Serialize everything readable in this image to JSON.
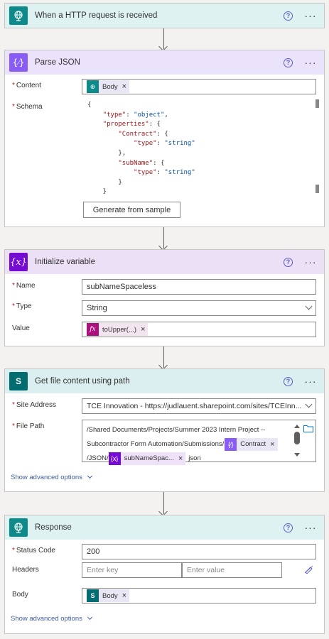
{
  "steps": {
    "trigger": {
      "title": "When a HTTP request is received",
      "help": "?",
      "more": "···"
    },
    "parse_json": {
      "title": "Parse JSON",
      "help": "?",
      "more": "···",
      "content_label": "Content",
      "content_token": "Body",
      "schema_label": "Schema",
      "schema_lines": [
        "{",
        "    \"type\": \"object\",",
        "    \"properties\": {",
        "        \"Contract\": {",
        "            \"type\": \"string\"",
        "        },",
        "        \"subName\": {",
        "            \"type\": \"string\"",
        "        }",
        "    }"
      ],
      "generate_button": "Generate from sample"
    },
    "init_var": {
      "title": "Initialize variable",
      "help": "?",
      "more": "···",
      "name_label": "Name",
      "name_value": "subNameSpaceless",
      "type_label": "Type",
      "type_value": "String",
      "value_label": "Value",
      "value_token": "toUpper(...)"
    },
    "get_file": {
      "title": "Get file content using path",
      "help": "?",
      "more": "···",
      "site_label": "Site Address",
      "site_value": "TCE Innovation - https://judlauent.sharepoint.com/sites/TCEInn...",
      "path_label": "File Path",
      "path_line1": "/Shared Documents/Projects/Summer 2023 Intern Project --",
      "path_line2": "Subcontractor Form Automation/Submissions/",
      "path_token1": "Contract",
      "path_line3a": "/JSON/",
      "path_token2": "subNameSpac...",
      "path_line3b": "json",
      "advanced": "Show advanced options"
    },
    "response": {
      "title": "Response",
      "help": "?",
      "more": "···",
      "status_label": "Status Code",
      "status_value": "200",
      "headers_label": "Headers",
      "key_placeholder": "Enter key",
      "value_placeholder": "Enter value",
      "body_label": "Body",
      "body_token": "Body",
      "advanced": "Show advanced options"
    }
  },
  "icons": {
    "request": "globe-icon",
    "parse": "braces-icon",
    "variable": "variable-x-icon",
    "sharepoint": "sharepoint-icon",
    "response": "globe-icon",
    "folder": "folder-icon",
    "pencil": "pencil-icon",
    "close": "close-icon",
    "fx": "fx-icon"
  },
  "colors": {
    "request_teal": "#0f8a8a",
    "request_header_bg": "#def2f2",
    "parse_purple": "#8a5cf6",
    "parse_header_bg": "#ebe3fb",
    "variable_purple": "#770bd6",
    "variable_header_bg": "#ebe0f6",
    "sharepoint_teal": "#036c70",
    "sharepoint_header_bg": "#dbeff0",
    "fx_magenta": "#ad0f7c"
  }
}
